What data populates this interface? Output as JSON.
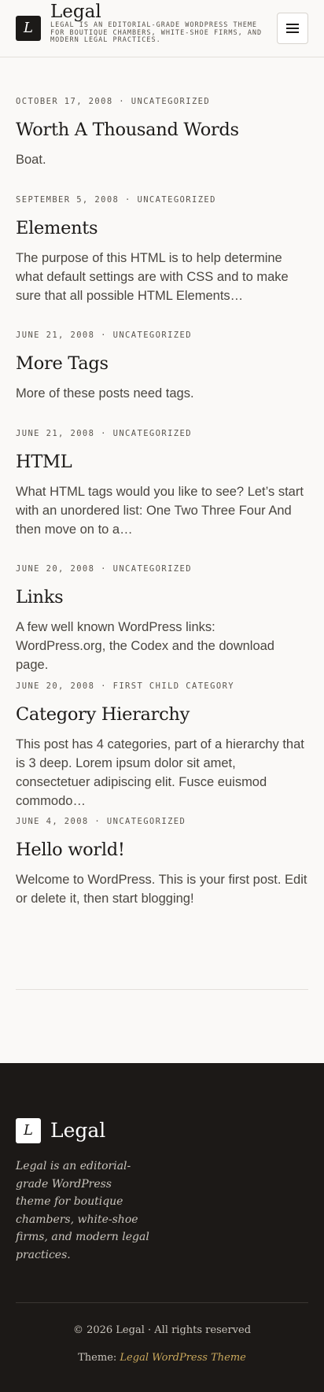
{
  "header": {
    "logo_letter": "L",
    "site_title": "Legal",
    "tagline": "Legal is an editorial-grade WordPress theme for boutique chambers, white-shoe firms, and modern legal practices.",
    "menu_icon": "hamburger-icon"
  },
  "posts": [
    {
      "date": "October 17, 2008",
      "separator": "·",
      "category": "Uncategorized",
      "title": "Worth A Thousand Words",
      "excerpt": "Boat."
    },
    {
      "date": "September 5, 2008",
      "separator": "·",
      "category": "Uncategorized",
      "title": "Elements",
      "excerpt": "The purpose of this HTML is to help determine what default settings are with CSS and to make sure that all possible HTML Elements…"
    },
    {
      "date": "June 21, 2008",
      "separator": "·",
      "category": "Uncategorized",
      "title": "More Tags",
      "excerpt": "More of these posts need tags."
    },
    {
      "date": "June 21, 2008",
      "separator": "·",
      "category": "Uncategorized",
      "title": "HTML",
      "excerpt": "What HTML tags would you like to see? Let’s start with an unordered list: One Two Three Four And then move on to a…"
    },
    {
      "date": "June 20, 2008",
      "separator": "·",
      "category": "Uncategorized",
      "title": "Links",
      "excerpt": "A few well known WordPress links: WordPress.org, the Codex and the download page."
    },
    {
      "date": "June 20, 2008",
      "separator": "·",
      "category": "First Child Category",
      "title": "Category Hierarchy",
      "excerpt": "This post has 4 categories, part of a hierarchy that is 3 deep. Lorem ipsum dolor sit amet, consectetuer adipiscing elit. Fusce euismod commodo…"
    },
    {
      "date": "June 4, 2008",
      "separator": "·",
      "category": "Uncategorized",
      "title": "Hello world!",
      "excerpt": "Welcome to WordPress. This is your first post. Edit or delete it, then start blogging!"
    }
  ],
  "footer": {
    "logo_letter": "L",
    "site_title": "Legal",
    "description": "Legal is an editorial-grade WordPress theme for boutique chambers, white-shoe firms, and modern legal practices.",
    "copyright": "© 2026 Legal · All rights reserved",
    "theme_label": "Theme:",
    "theme_link": "Legal WordPress Theme"
  }
}
